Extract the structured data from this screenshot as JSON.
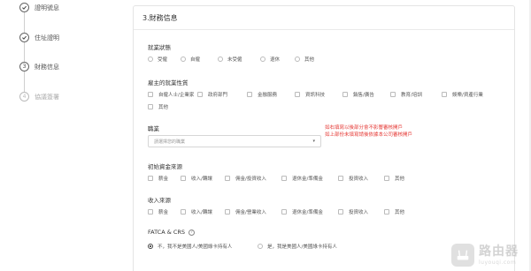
{
  "stepper": {
    "steps": [
      {
        "label": "證明號息",
        "state": "done",
        "num": ""
      },
      {
        "label": "住址證明",
        "state": "done",
        "num": ""
      },
      {
        "label": "財務信息",
        "state": "current",
        "num": "3"
      },
      {
        "label": "協議簽署",
        "state": "pending",
        "num": "4"
      }
    ]
  },
  "card": {
    "title": "3.財務信息"
  },
  "employment_status": {
    "label": "就業狀態",
    "options": [
      "受僱",
      "自僱",
      "未受僱",
      "退休",
      "其他"
    ]
  },
  "employer_nature": {
    "label": "雇主的就業性質",
    "options": [
      "自僱人士/企業家",
      "政府部門",
      "金融服務",
      "資訊科技",
      "銷售/廣告",
      "教育/培訓",
      "娛樂/資產行業",
      "其他"
    ]
  },
  "occupation": {
    "label": "職業",
    "placeholder": "請選擇您的職業"
  },
  "note": {
    "line1": "如右填寫以後部分會不影響審核開戶",
    "line2": "如上部份未填寫請後依據本公司審核開戶"
  },
  "initial_funds": {
    "label": "初始資金來源",
    "options": [
      "薪金",
      "收入/轉讓",
      "佣金/投資收入",
      "退休金/準備金",
      "投資收入",
      "其他"
    ]
  },
  "income_source": {
    "label": "收入來源",
    "options": [
      "薪金",
      "收入/轉讓",
      "佣金/營業收入",
      "退休金/準備金",
      "投資收入",
      "其他"
    ]
  },
  "fatca": {
    "label": "FATCA & CRS",
    "options": [
      "不，我不是美國人/美國綠卡持有人",
      "是，我是美國人/美國綠卡持有人"
    ],
    "selected_index": 0
  },
  "watermark": {
    "main": "路由器",
    "sub": "luyouqi.com"
  }
}
